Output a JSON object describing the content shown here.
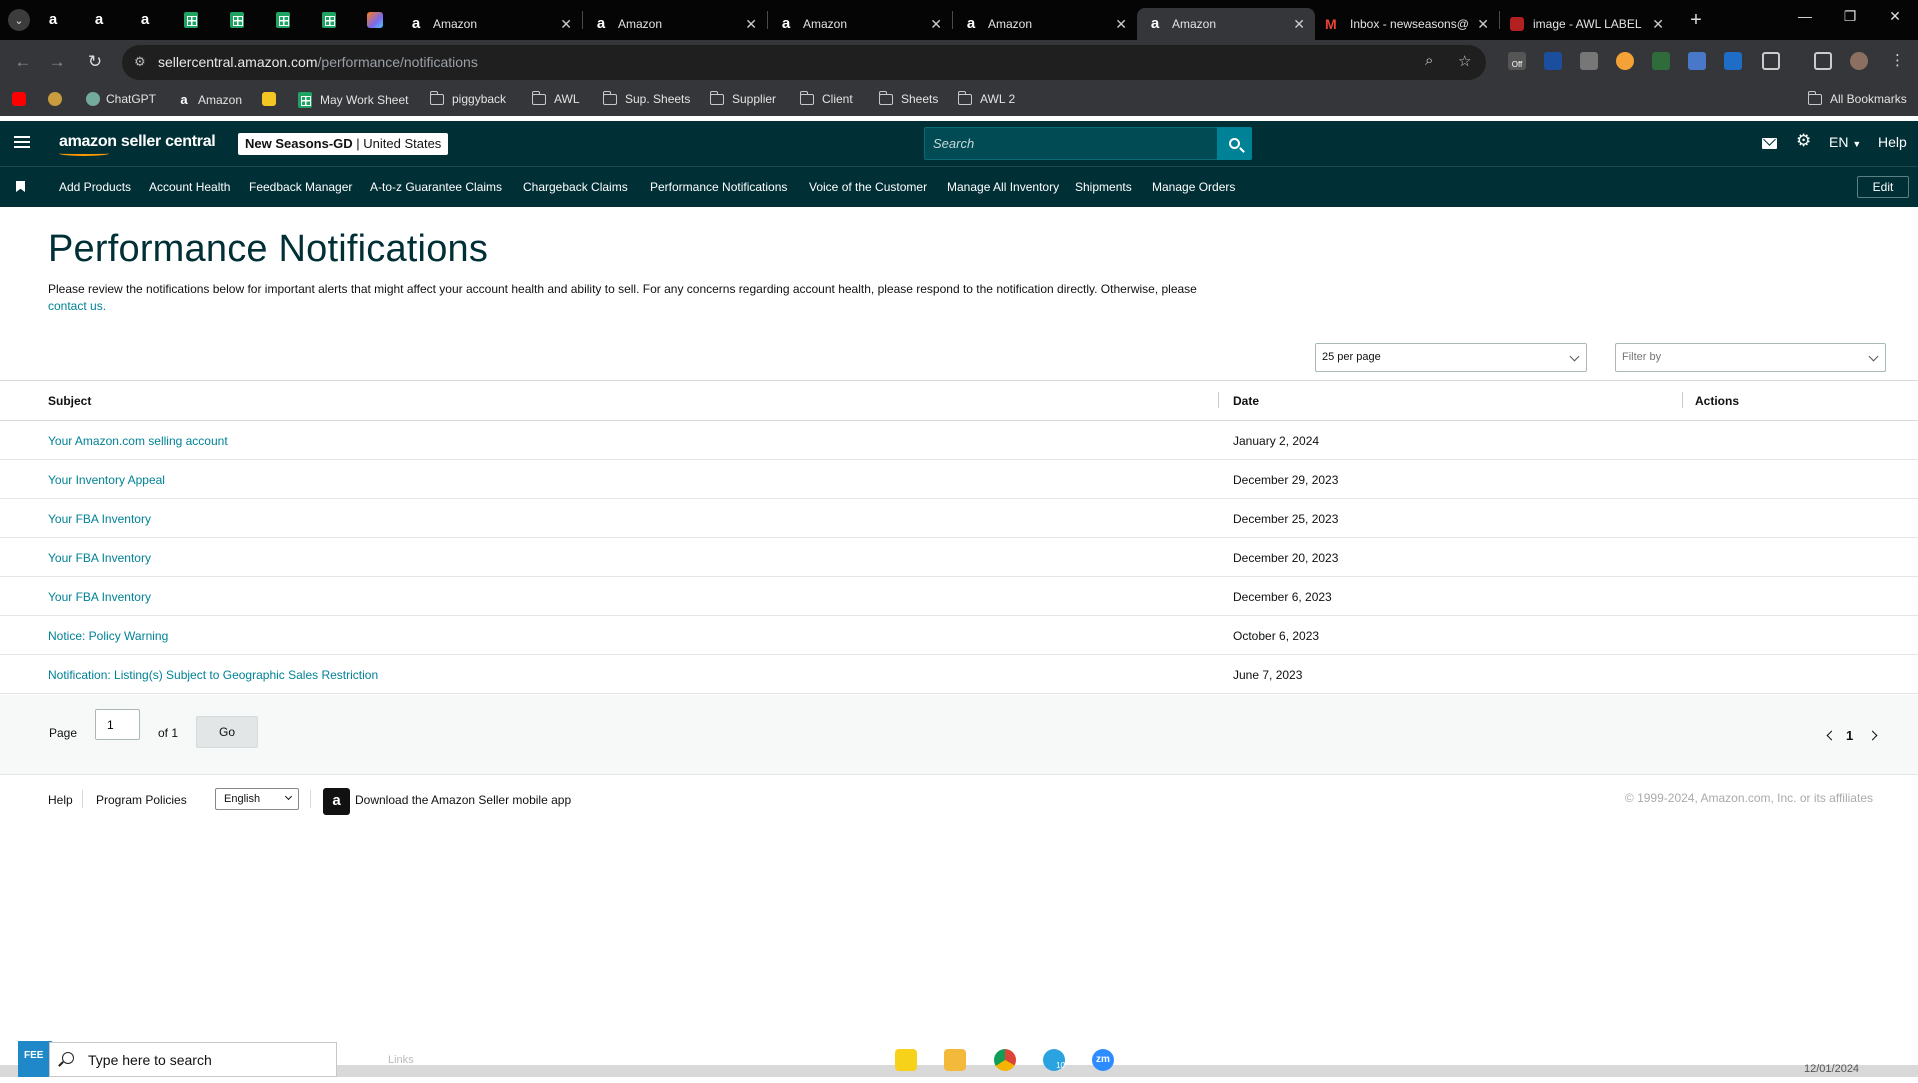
{
  "browser": {
    "tabs": [
      {
        "title": "Amazon",
        "active": false
      },
      {
        "title": "Amazon",
        "active": false
      },
      {
        "title": "Amazon",
        "active": false
      },
      {
        "title": "Amazon",
        "active": false
      },
      {
        "title": "Amazon",
        "active": true
      },
      {
        "title": "Inbox - newseasons@",
        "active": false
      },
      {
        "title": "image - AWL LABEL",
        "active": false
      }
    ],
    "url_domain": "sellercentral.amazon.com",
    "url_path": "/performance/notifications",
    "bookmarks": [
      "ChatGPT",
      "Amazon",
      "May Work Sheet",
      "piggyback",
      "AWL",
      "Sup. Sheets",
      "Supplier",
      "Client",
      "Sheets",
      "AWL 2"
    ],
    "all_bookmarks": "All Bookmarks",
    "ext_badge": "Off"
  },
  "header": {
    "logo_text": "amazon seller central",
    "store_name": "New Seasons-GD",
    "marketplace": "United States",
    "search_placeholder": "Search",
    "language": "EN",
    "help": "Help"
  },
  "nav": {
    "items": [
      "Add Products",
      "Account Health",
      "Feedback Manager",
      "A-to-z Guarantee Claims",
      "Chargeback Claims",
      "Performance Notifications",
      "Voice of the Customer",
      "Manage All Inventory",
      "Shipments",
      "Manage Orders"
    ],
    "edit": "Edit"
  },
  "page": {
    "title": "Performance Notifications",
    "intro": "Please review the notifications below for important alerts that might affect your account health and ability to sell. For any concerns regarding account health, please respond to the notification directly. Otherwise, please",
    "contact_link": "contact us.",
    "per_page": "25 per page",
    "filter_placeholder": "Filter by"
  },
  "table": {
    "headers": {
      "subject": "Subject",
      "date": "Date",
      "actions": "Actions"
    },
    "rows": [
      {
        "subject": "Your Amazon.com selling account",
        "date": "January 2, 2024"
      },
      {
        "subject": "Your Inventory Appeal",
        "date": "December 29, 2023"
      },
      {
        "subject": "Your FBA Inventory",
        "date": "December 25, 2023"
      },
      {
        "subject": "Your FBA Inventory",
        "date": "December 20, 2023"
      },
      {
        "subject": "Your FBA Inventory",
        "date": "December 6, 2023"
      },
      {
        "subject": "Notice: Policy Warning",
        "date": "October 6, 2023"
      },
      {
        "subject": "Notification: Listing(s) Subject to Geographic Sales Restriction",
        "date": "June 7, 2023"
      }
    ]
  },
  "pagination": {
    "page_label": "Page",
    "page_value": "1",
    "of_label": "of 1",
    "go": "Go",
    "current": "1"
  },
  "footer": {
    "help": "Help",
    "program_policies": "Program Policies",
    "language": "English",
    "app_download": "Download the Amazon Seller mobile app",
    "copyright": "© 1999-2024, Amazon.com, Inc. or its affiliates"
  },
  "taskbar": {
    "search_placeholder": "Type here to search",
    "links": "Links",
    "date": "12/01/2024",
    "badge": "10"
  }
}
